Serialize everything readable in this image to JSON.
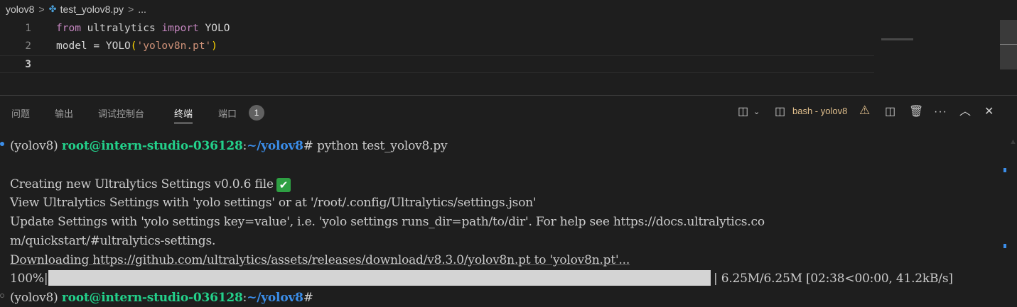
{
  "breadcrumb": {
    "folder": "yolov8",
    "file": "test_yolov8.py",
    "ellipsis": "...",
    "separator": ">"
  },
  "editor": {
    "lines": [
      {
        "num": "1",
        "kw1": "from",
        "mod": "ultralytics",
        "kw2": "import",
        "cls": "YOLO"
      },
      {
        "num": "2",
        "var": "model",
        "eq": " = ",
        "cls": "YOLO",
        "open": "(",
        "arg": "'yolov8n.pt'",
        "close": ")"
      },
      {
        "num": "3"
      }
    ]
  },
  "panel": {
    "tabs": [
      "问题",
      "输出",
      "调试控制台",
      "终端",
      "端口"
    ],
    "active_tab": "终端",
    "ports_count": "1",
    "terminal_name": "bash - yolov8"
  },
  "terminal": {
    "prompt_env": "(yolov8) ",
    "prompt_user": "root@intern-studio-036128",
    "prompt_colon": ":",
    "prompt_path": "~/yolov8",
    "prompt_end": "#",
    "command": " python test_yolov8.py",
    "settings_line": "Creating new Ultralytics Settings v0.0.6 file",
    "view_line": "View Ultralytics Settings with 'yolo settings' or at '/root/.config/Ultralytics/settings.json'",
    "update_line_1": "Update Settings with 'yolo settings key=value', i.e. 'yolo settings runs_dir=path/to/dir'. For help see https://docs.ultralytics.co",
    "update_line_2": "m/quickstart/#ultralytics-settings.",
    "download_line": "Downloading https://github.com/ultralytics/assets/releases/download/v8.3.0/yolov8n.pt to 'yolov8n.pt'...",
    "progress_percent": "100%",
    "progress_fraction": 1.0,
    "progress_stats": "| 6.25M/6.25M [02:38<00:00, 41.2kB/s]"
  },
  "colors": {
    "accent_green": "#23d18b",
    "accent_blue": "#3b8eea",
    "warning": "#e2c08d"
  }
}
